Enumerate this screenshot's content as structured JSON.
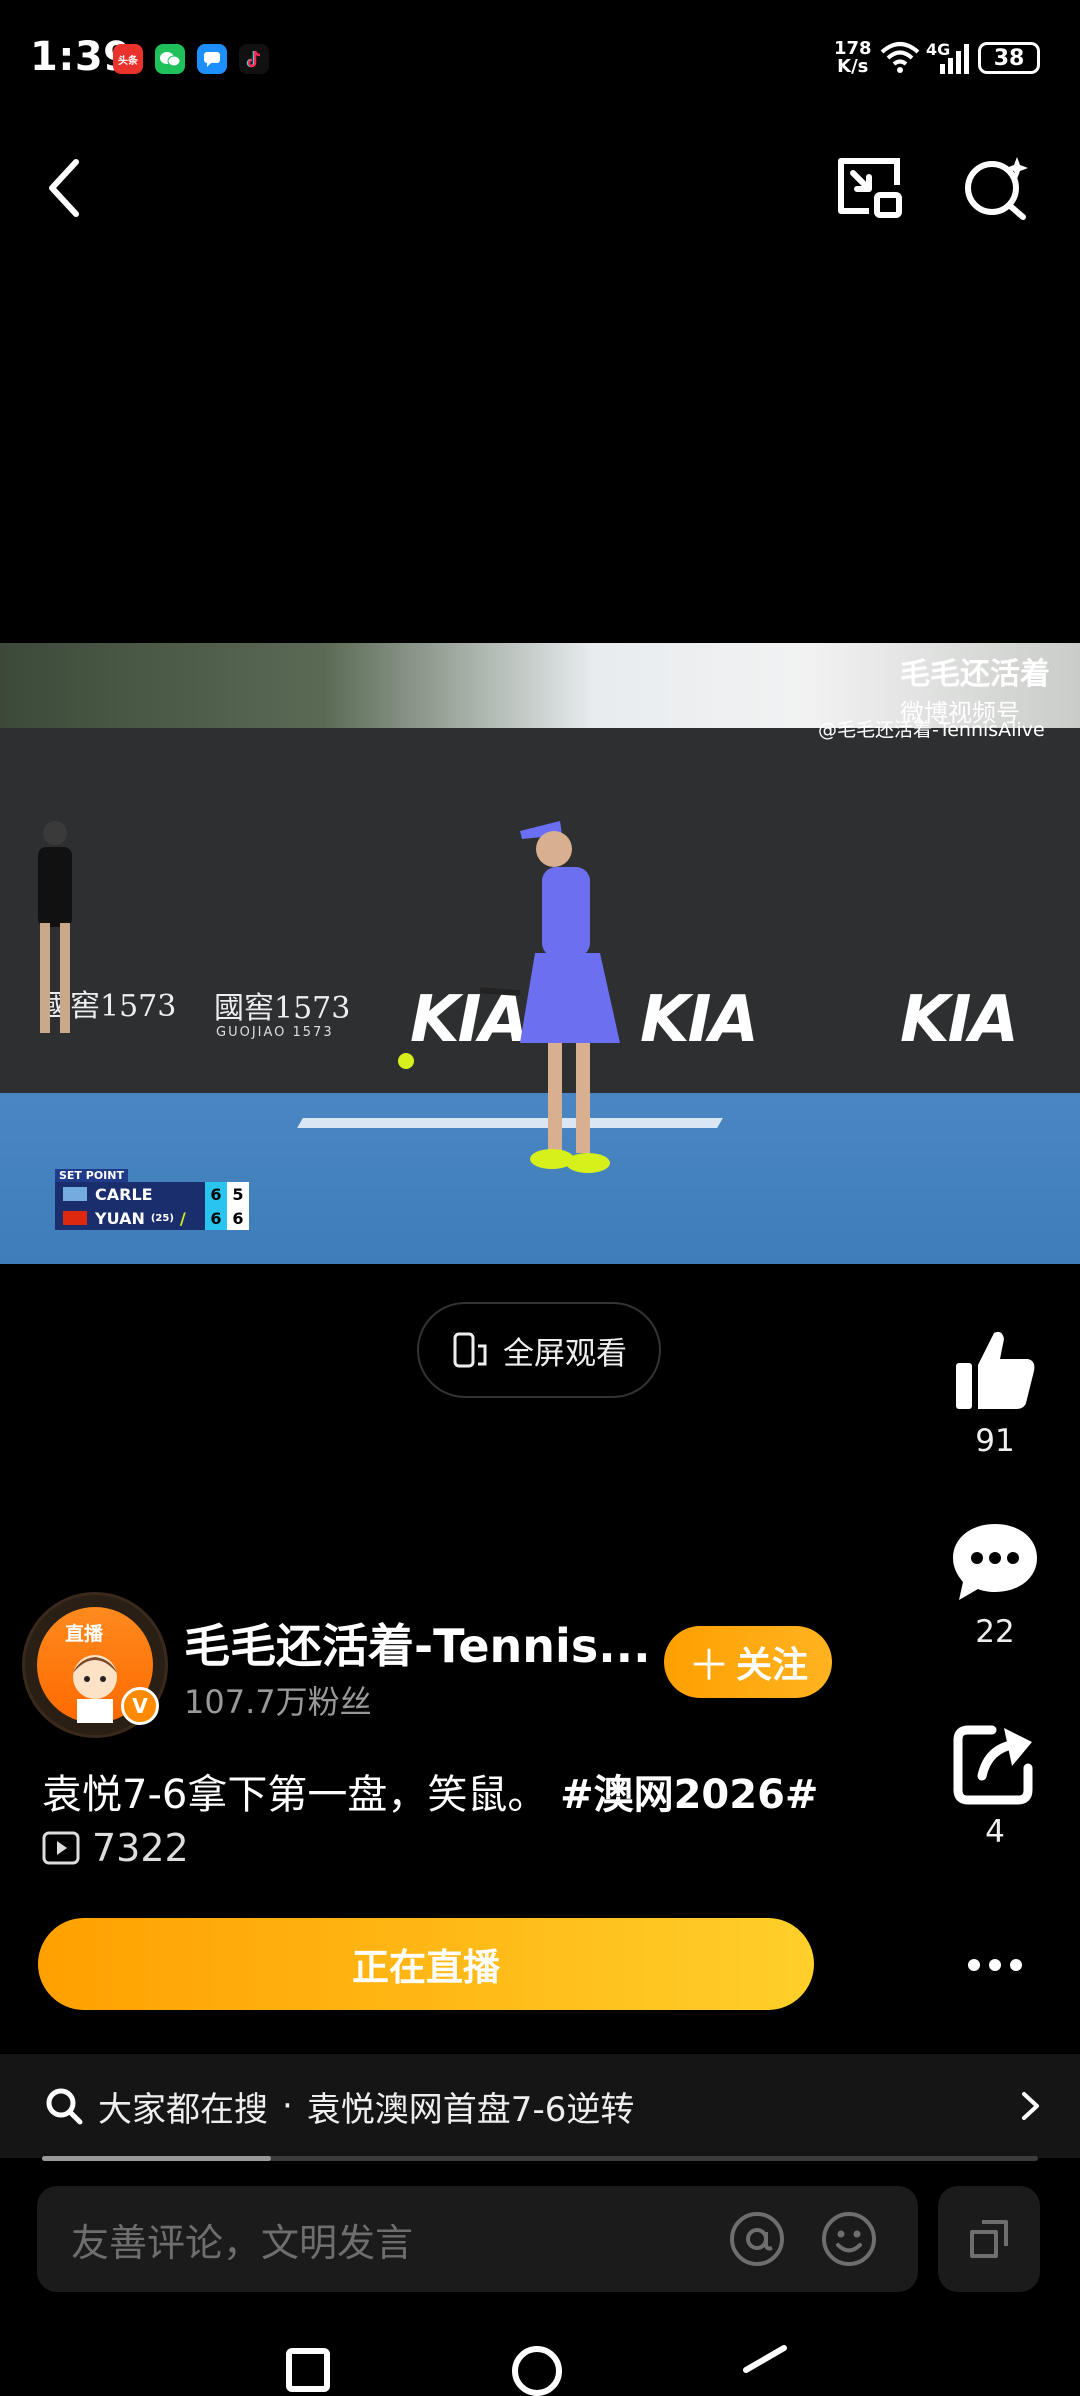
{
  "status_bar": {
    "time": "1:39",
    "net_speed_value": "178",
    "net_speed_unit": "K/s",
    "network": "4G",
    "battery": "38",
    "app_icons": [
      {
        "name": "toutiao",
        "label": "头条",
        "color": "#e8322b"
      },
      {
        "name": "wechat",
        "label": "",
        "color": "#1fc15b"
      },
      {
        "name": "message",
        "label": "",
        "color": "#1e8fff"
      },
      {
        "name": "douyin",
        "label": "",
        "color": "#111111"
      }
    ]
  },
  "video": {
    "watermark_title": "毛毛还活着",
    "watermark_sub": "微博视频号",
    "watermark_handle": "@毛毛还活着-TennisAlive",
    "sponsor_small": "國窖1573",
    "sponsor_small_sub": "GUOJIAO 1573",
    "sponsor_main": "KIA",
    "scoreboard": {
      "label": "SET POINT",
      "rows": [
        {
          "player": "CARLE",
          "seed": "",
          "set": "6",
          "game": "5"
        },
        {
          "player": "YUAN",
          "seed": "(25)",
          "set": "6",
          "game": "6"
        }
      ]
    }
  },
  "fullscreen_label": "全屏观看",
  "actions": {
    "like_count": "91",
    "comment_count": "22",
    "share_count": "4"
  },
  "author": {
    "avatar_badge": "直播",
    "name": "毛毛还活着-Tennis...",
    "fans": "107.7万粉丝",
    "follow_label": "关注"
  },
  "caption": {
    "text": "袁悦7-6拿下第一盘，笑鼠。",
    "tag": "#澳网2026#"
  },
  "views": "7322",
  "live_label": "正在直播",
  "search": {
    "prefix": "大家都在搜",
    "separator": "·",
    "query": "袁悦澳网首盘7-6逆转"
  },
  "progress_fraction": 0.23,
  "comment_placeholder": "友善评论，文明发言",
  "colors": {
    "accent_orange": "#ffa000",
    "accent_yellow": "#ffcf2a"
  }
}
